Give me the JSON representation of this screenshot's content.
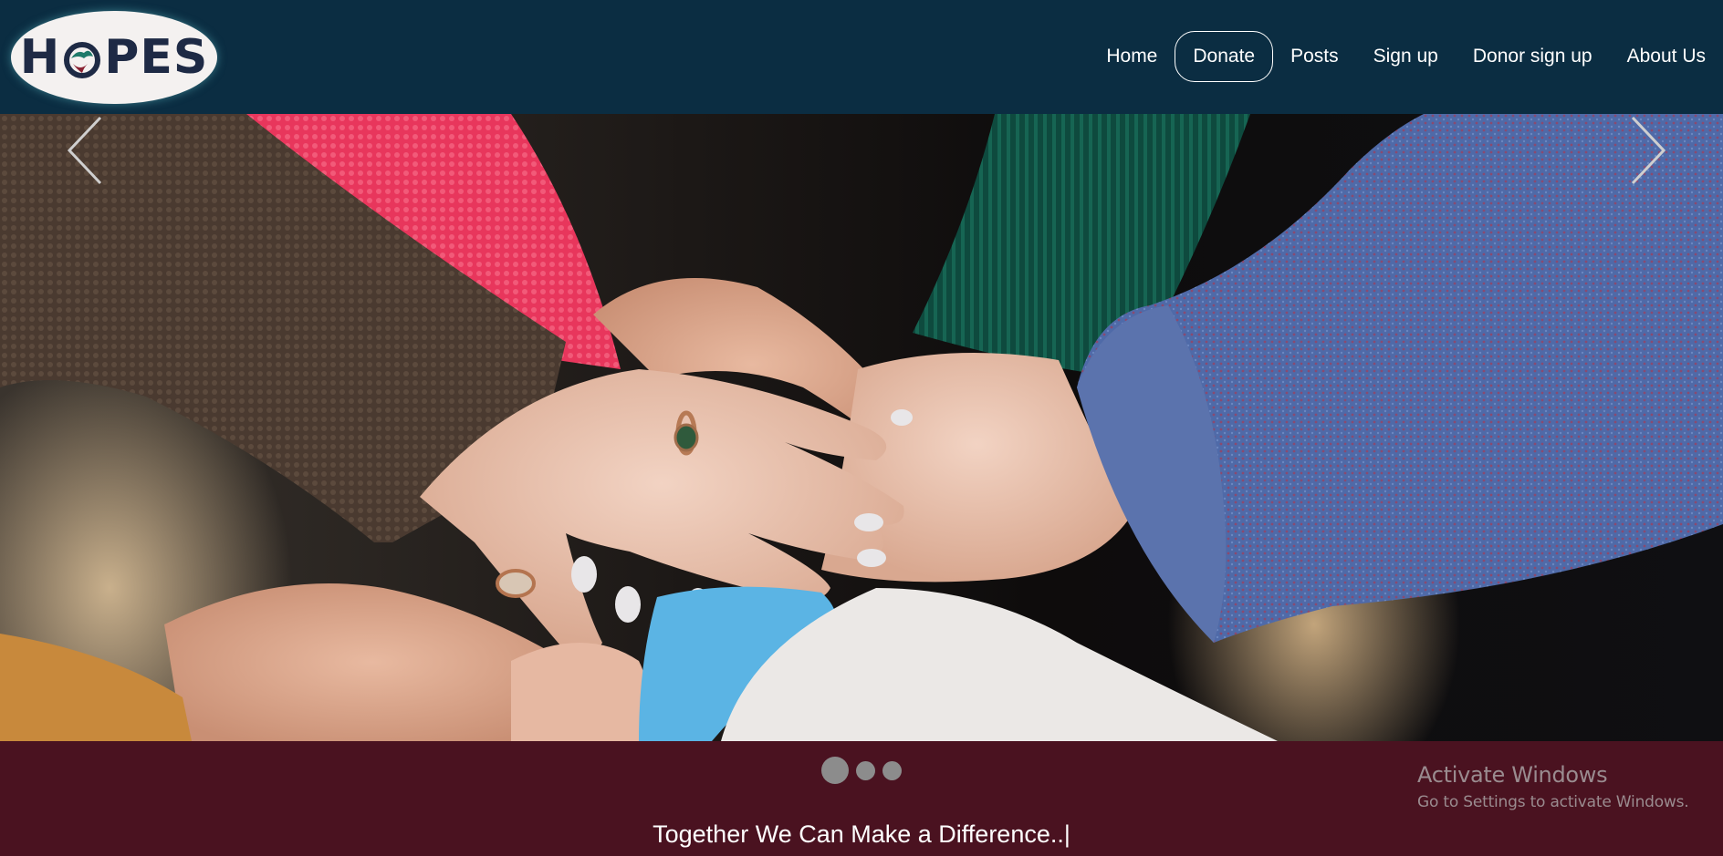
{
  "brand": {
    "logo_text": "HOPES",
    "logo_left": "H",
    "logo_right": "PES"
  },
  "nav": {
    "items": [
      {
        "label": "Home",
        "active": false
      },
      {
        "label": "Donate",
        "active": true
      },
      {
        "label": "Posts",
        "active": false
      },
      {
        "label": "Sign up",
        "active": false
      },
      {
        "label": "Donor sign up",
        "active": false
      },
      {
        "label": "About Us",
        "active": false
      }
    ]
  },
  "carousel": {
    "slide_count": 3,
    "active_slide": 1,
    "prev_icon": "chevron-left-icon",
    "next_icon": "chevron-right-icon"
  },
  "tagline": "Together We Can Make a Difference..|",
  "watermark": {
    "title": "Activate Windows",
    "subtitle": "Go to Settings to activate Windows."
  },
  "colors": {
    "header_bg": "#0b2d42",
    "band_bg": "#4a1220",
    "logo_text": "#1e2a45",
    "logo_accent_green": "#1f7a6a",
    "logo_accent_red": "#8a2232"
  }
}
